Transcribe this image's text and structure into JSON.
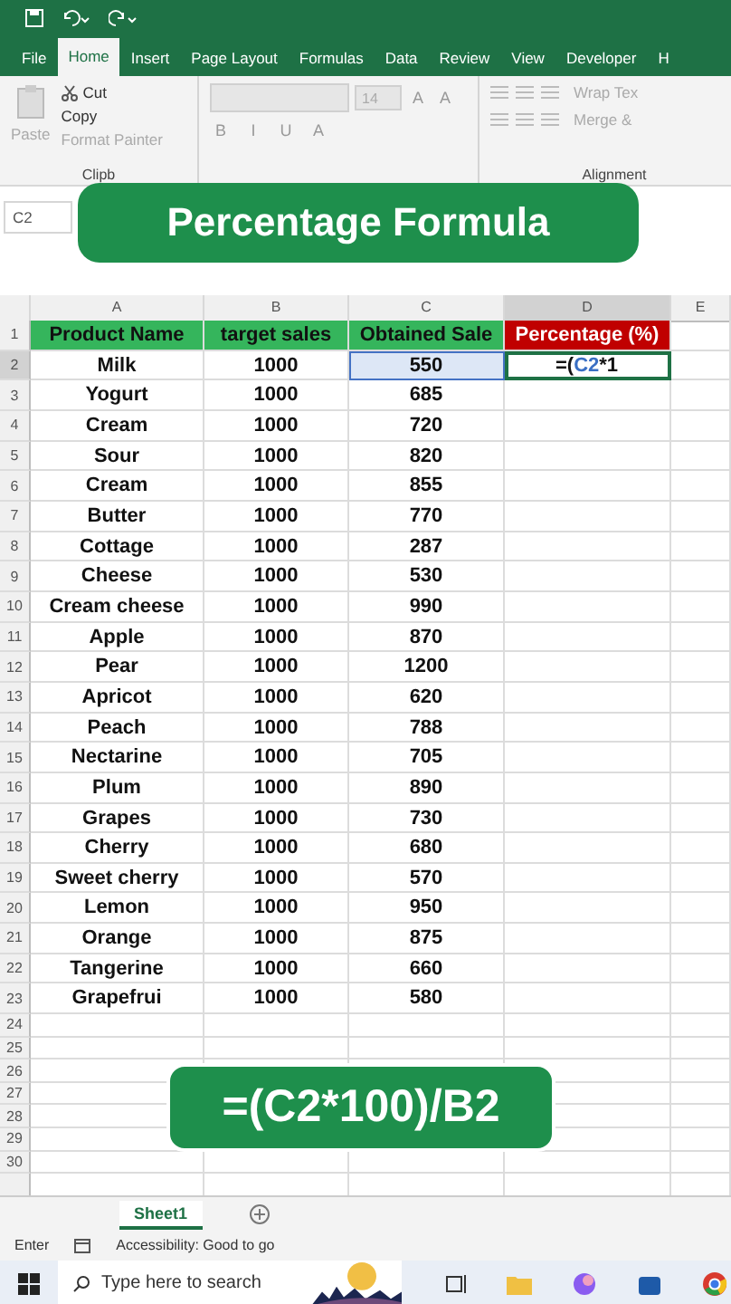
{
  "menu_tabs": [
    {
      "label": "File",
      "selected": false
    },
    {
      "label": "Home",
      "selected": true
    },
    {
      "label": "Insert",
      "selected": false
    },
    {
      "label": "Page Layout",
      "selected": false
    },
    {
      "label": "Formulas",
      "selected": false
    },
    {
      "label": "Data",
      "selected": false
    },
    {
      "label": "Review",
      "selected": false
    },
    {
      "label": "View",
      "selected": false
    },
    {
      "label": "Developer",
      "selected": false
    },
    {
      "label": "H",
      "selected": false
    }
  ],
  "ribbon": {
    "paste": "Paste",
    "cut": "Cut",
    "copy": "Copy",
    "format_painter": "Format Painter",
    "clipboard_label": "Clipb",
    "font_size": "14",
    "size_buttons": [
      "A",
      "A"
    ],
    "font_buttons": [
      "B",
      "I",
      "U",
      "A"
    ],
    "wrap": "Wrap Tex",
    "merge": "Merge &",
    "alignment_label": "Alignment"
  },
  "name_box": "C2",
  "banner_title": "Percentage Formula",
  "columns": [
    {
      "label": "A",
      "selected": false
    },
    {
      "label": "B",
      "selected": false
    },
    {
      "label": "C",
      "selected": false
    },
    {
      "label": "D",
      "selected": true
    },
    {
      "label": "E",
      "selected": false
    }
  ],
  "header_row": {
    "number": "1",
    "cells": [
      {
        "text": "Product Name",
        "kind": "green"
      },
      {
        "text": "target sales",
        "kind": "green"
      },
      {
        "text": "Obtained Sale",
        "kind": "green"
      },
      {
        "text": "Percentage (%)",
        "kind": "red"
      }
    ]
  },
  "rows": [
    {
      "number": "2",
      "selected": true,
      "cells": [
        "Milk",
        "1000",
        "550"
      ]
    },
    {
      "number": "3",
      "selected": false,
      "cells": [
        "Yogurt",
        "1000",
        "685"
      ]
    },
    {
      "number": "4",
      "selected": false,
      "cells": [
        "Cream",
        "1000",
        "720"
      ]
    },
    {
      "number": "5",
      "selected": false,
      "cells": [
        "Sour",
        "1000",
        "820"
      ]
    },
    {
      "number": "6",
      "selected": false,
      "cells": [
        "Cream",
        "1000",
        "855"
      ]
    },
    {
      "number": "7",
      "selected": false,
      "cells": [
        "Butter",
        "1000",
        "770"
      ]
    },
    {
      "number": "8",
      "selected": false,
      "cells": [
        "Cottage",
        "1000",
        "287"
      ]
    },
    {
      "number": "9",
      "selected": false,
      "cells": [
        "Cheese",
        "1000",
        "530"
      ]
    },
    {
      "number": "10",
      "selected": false,
      "cells": [
        "Cream cheese",
        "1000",
        "990"
      ]
    },
    {
      "number": "11",
      "selected": false,
      "cells": [
        "Apple",
        "1000",
        "870"
      ]
    },
    {
      "number": "12",
      "selected": false,
      "cells": [
        "Pear",
        "1000",
        "1200"
      ]
    },
    {
      "number": "13",
      "selected": false,
      "cells": [
        "Apricot",
        "1000",
        "620"
      ]
    },
    {
      "number": "14",
      "selected": false,
      "cells": [
        "Peach",
        "1000",
        "788"
      ]
    },
    {
      "number": "15",
      "selected": false,
      "cells": [
        "Nectarine",
        "1000",
        "705"
      ]
    },
    {
      "number": "16",
      "selected": false,
      "cells": [
        "Plum",
        "1000",
        "890"
      ]
    },
    {
      "number": "17",
      "selected": false,
      "cells": [
        "Grapes",
        "1000",
        "730"
      ]
    },
    {
      "number": "18",
      "selected": false,
      "cells": [
        "Cherry",
        "1000",
        "680"
      ]
    },
    {
      "number": "19",
      "selected": false,
      "cells": [
        "Sweet cherry",
        "1000",
        "570"
      ]
    },
    {
      "number": "20",
      "selected": false,
      "cells": [
        "Lemon",
        "1000",
        "950"
      ]
    },
    {
      "number": "21",
      "selected": false,
      "cells": [
        "Orange",
        "1000",
        "875"
      ]
    },
    {
      "number": "22",
      "selected": false,
      "cells": [
        "Tangerine",
        "1000",
        "660"
      ]
    },
    {
      "number": "23",
      "selected": false,
      "cells": [
        "Grapefrui",
        "1000",
        "580"
      ]
    }
  ],
  "formula_parts": [
    {
      "text": "=(",
      "kind": "plain"
    },
    {
      "text": "C2",
      "kind": "ref"
    },
    {
      "text": "*1",
      "kind": "plain"
    }
  ],
  "empty_rows": [
    "24",
    "25",
    "26",
    "27",
    "28",
    "29",
    "30"
  ],
  "formula_banner": "=(C2*100)/B2",
  "sheet_tabs": [
    {
      "label": "Sheet1",
      "selected": true
    }
  ],
  "status": {
    "mode": "Enter",
    "accessibility": "Accessibility: Good to go"
  },
  "taskbar": {
    "search_placeholder": "Type here to search"
  }
}
